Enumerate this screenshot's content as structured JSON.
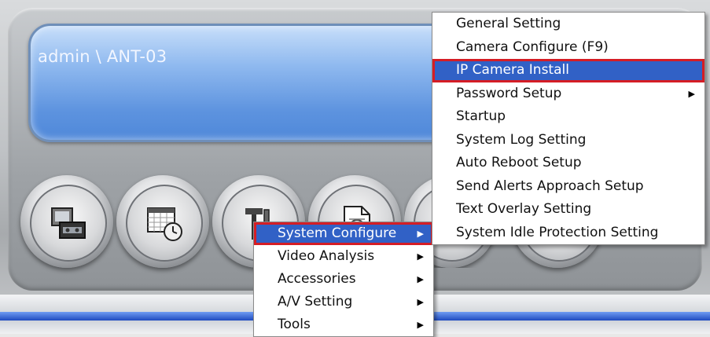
{
  "window": {
    "user_path": "admin \\ ANT-03"
  },
  "toolbar": {
    "buttons": [
      {
        "name": "playback",
        "icon": "monitor-tape-icon"
      },
      {
        "name": "schedule",
        "icon": "calendar-clock-icon"
      },
      {
        "name": "setup",
        "icon": "hammer-tool-icon"
      },
      {
        "name": "report",
        "icon": "document-icon"
      }
    ]
  },
  "main_menu": {
    "items": [
      {
        "label": "System Configure",
        "has_submenu": true,
        "active": true
      },
      {
        "label": "Video Analysis",
        "has_submenu": true
      },
      {
        "label": "Accessories",
        "has_submenu": true
      },
      {
        "label": "A/V Setting",
        "has_submenu": true
      },
      {
        "label": "Tools",
        "has_submenu": true
      }
    ]
  },
  "submenu": {
    "items": [
      {
        "label": "General Setting"
      },
      {
        "label": "Camera Configure (F9)"
      },
      {
        "label": "IP Camera Install",
        "active": true
      },
      {
        "label": "Password Setup",
        "has_submenu": true
      },
      {
        "label": "Startup"
      },
      {
        "label": "System Log Setting"
      },
      {
        "label": "Auto Reboot Setup"
      },
      {
        "label": "Send Alerts Approach Setup"
      },
      {
        "label": "Text Overlay Setting"
      },
      {
        "label": "System Idle Protection Setting"
      }
    ]
  },
  "colors": {
    "highlight": "#3161c6",
    "annotation_red": "#d51d25",
    "lcd_blue": "#5d93df"
  }
}
